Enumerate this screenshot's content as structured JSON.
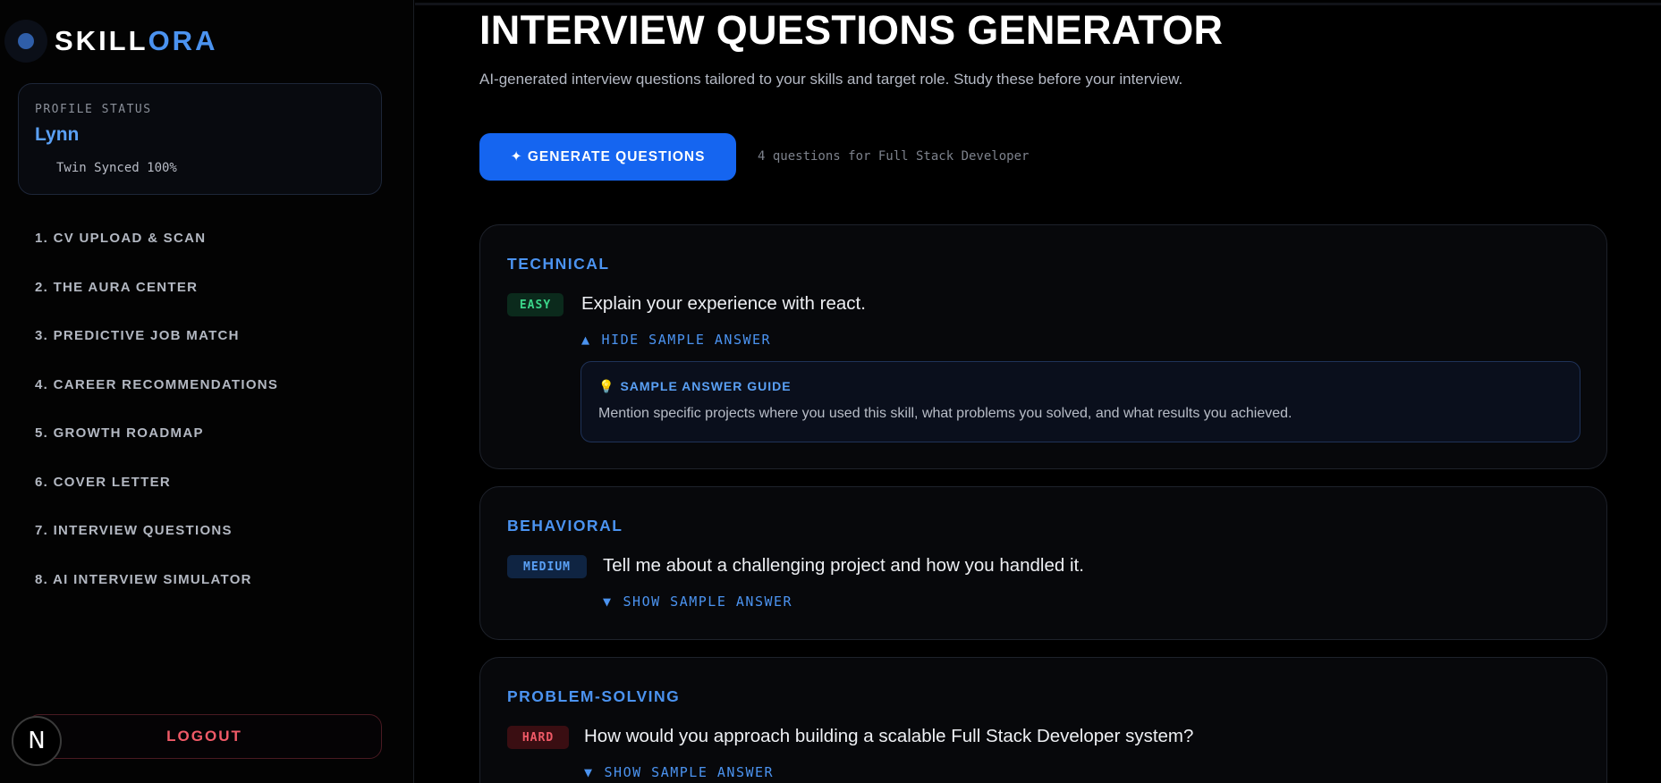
{
  "brand": {
    "part1": "SKILL",
    "part2": "ORA"
  },
  "profile": {
    "label": "PROFILE STATUS",
    "name": "Lynn",
    "sync": "Twin Synced 100%"
  },
  "nav": [
    "1. CV UPLOAD & SCAN",
    "2. THE AURA CENTER",
    "3. PREDICTIVE JOB MATCH",
    "4. CAREER RECOMMENDATIONS",
    "5. GROWTH ROADMAP",
    "6. COVER LETTER",
    "7. INTERVIEW QUESTIONS",
    "8. AI INTERVIEW SIMULATOR"
  ],
  "logout_label": "LOGOUT",
  "n_badge": "N",
  "page": {
    "title": "INTERVIEW QUESTIONS GENERATOR",
    "subtitle": "AI-generated interview questions tailored to your skills and target role. Study these before your interview.",
    "generate_label": "✦ GENERATE QUESTIONS",
    "generate_info": "4 questions for Full Stack Developer"
  },
  "questions": [
    {
      "category": "TECHNICAL",
      "difficulty": "EASY",
      "text": "Explain your experience with react.",
      "toggle_icon": "▲",
      "toggle_label": "HIDE SAMPLE ANSWER",
      "answer_title": "SAMPLE ANSWER GUIDE",
      "answer_icon": "💡",
      "answer_text": "Mention specific projects where you used this skill, what problems you solved, and what results you achieved."
    },
    {
      "category": "BEHAVIORAL",
      "difficulty": "MEDIUM",
      "text": "Tell me about a challenging project and how you handled it.",
      "toggle_icon": "▼",
      "toggle_label": "SHOW SAMPLE ANSWER"
    },
    {
      "category": "PROBLEM-SOLVING",
      "difficulty": "HARD",
      "text": "How would you approach building a scalable Full Stack Developer system?",
      "toggle_icon": "▼",
      "toggle_label": "SHOW SAMPLE ANSWER"
    }
  ],
  "colors": {
    "accent": "#4b93f0",
    "primary_button": "#1565f0",
    "easy": "#3bd68a",
    "medium": "#5aa0f5",
    "hard": "#f05a67",
    "logout": "#f05a67"
  }
}
